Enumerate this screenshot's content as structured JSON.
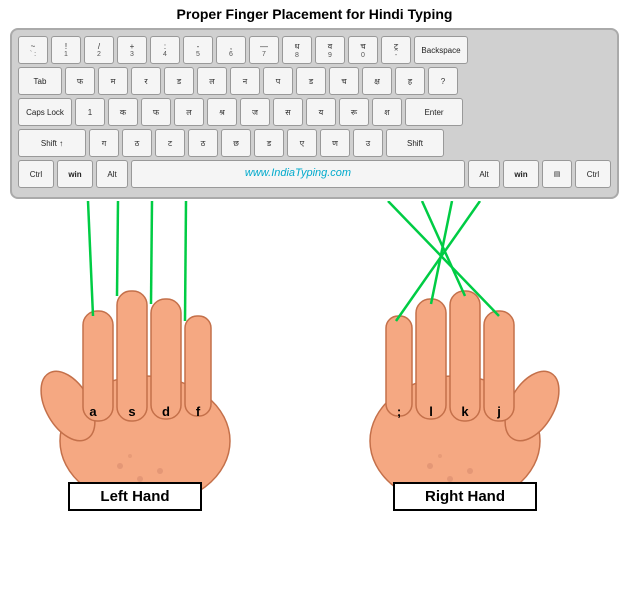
{
  "title": "Proper Finger Placement for Hindi Typing",
  "website": "www.IndiaTyping.com",
  "left_hand_label": "Left Hand",
  "right_hand_label": "Right Hand",
  "keyboard": {
    "row1": [
      "` `, 1",
      "!, 1",
      "/, 2",
      "+, 3",
      ":, 4",
      "-, 5",
      ",, 6",
      "-, 7",
      "8",
      "0",
      "ट्र",
      "Backspace"
    ],
    "row2": [
      "Tab",
      "फ",
      "म",
      "र",
      "ड",
      "ल",
      "न",
      "प",
      "ड",
      "च",
      "क्ष",
      "ह",
      "?"
    ],
    "row3": [
      "Caps Lock",
      "1",
      "क",
      "फ",
      "ल",
      "श्र",
      "ज",
      "स",
      "य",
      "रू",
      "Enter"
    ],
    "row4": [
      "Shift ↑",
      "ग",
      "ठ",
      "ट",
      "ठ",
      "छ",
      "ड",
      "ए",
      "ण",
      "Shift"
    ],
    "row5": [
      "Ctrl",
      "win",
      "Alt",
      "www.IndiaTyping.com",
      "Alt",
      "win",
      "▤",
      "Ctrl"
    ]
  },
  "fingers": {
    "left": [
      "a",
      "s",
      "d",
      "f"
    ],
    "right": [
      "j",
      "k",
      "l",
      ";"
    ]
  },
  "colors": {
    "line": "#00cc44",
    "border": "#000000",
    "key_bg": "#f5f5f5",
    "keyboard_bg": "#d0d0d0"
  }
}
